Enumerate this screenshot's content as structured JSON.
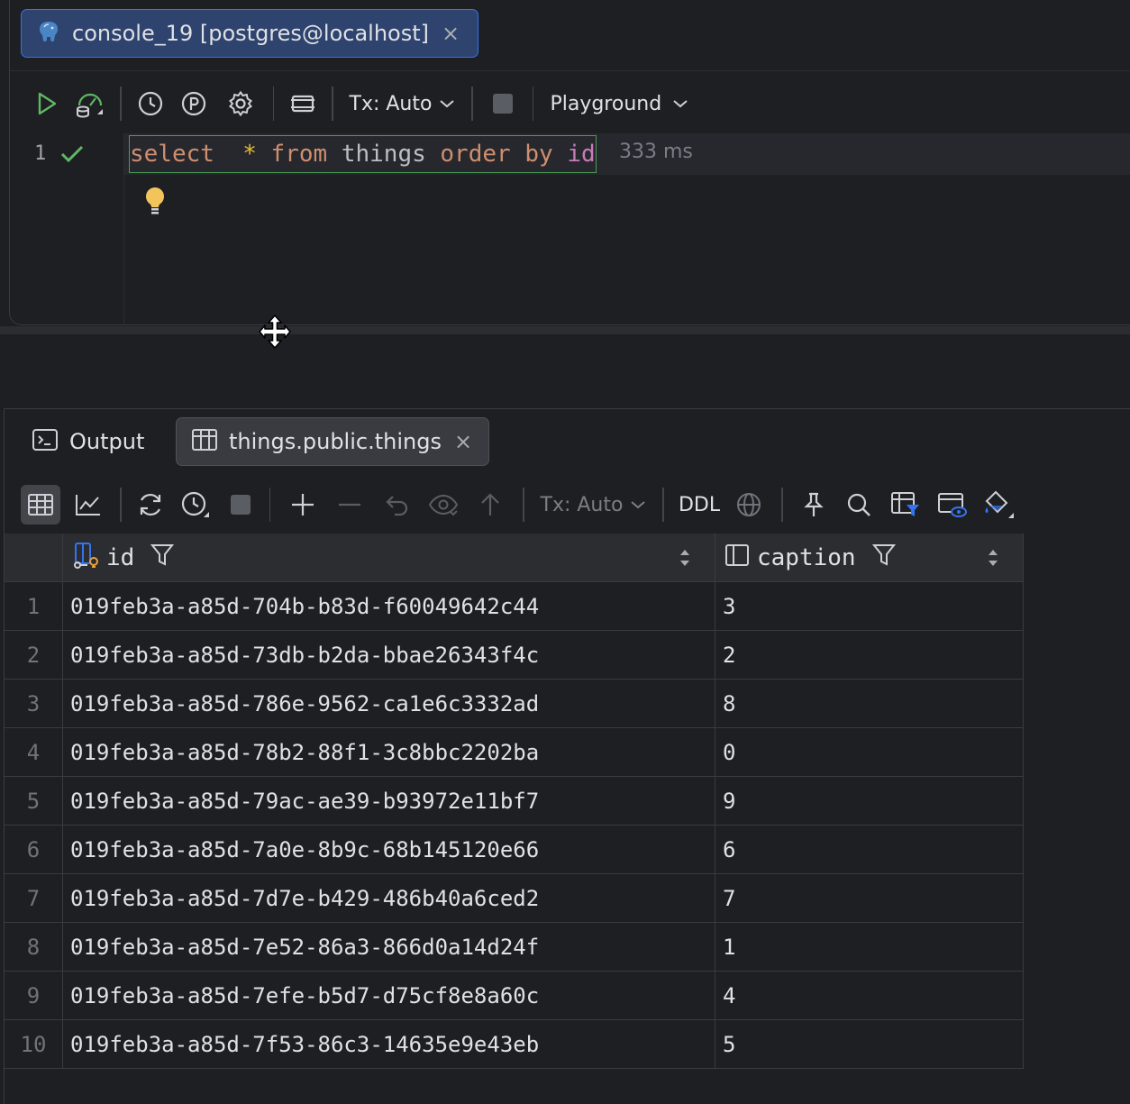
{
  "editor": {
    "tab": {
      "label": "console_19 [postgres@localhost]",
      "icon": "postgres-elephant-icon"
    },
    "toolbar": {
      "tx_mode": "Tx: Auto",
      "session": "Playground"
    },
    "line_number": "1",
    "query_tokens": [
      {
        "text": "select",
        "kind": "kw"
      },
      {
        "text": "  ",
        "kind": "ident"
      },
      {
        "text": "*",
        "kind": "op"
      },
      {
        "text": " ",
        "kind": "ident"
      },
      {
        "text": "from",
        "kind": "kw"
      },
      {
        "text": " things ",
        "kind": "ident"
      },
      {
        "text": "order",
        "kind": "kw"
      },
      {
        "text": " ",
        "kind": "ident"
      },
      {
        "text": "by",
        "kind": "kw"
      },
      {
        "text": " ",
        "kind": "ident"
      },
      {
        "text": "id",
        "kind": "col"
      }
    ],
    "timing": "333 ms"
  },
  "results": {
    "tabs": [
      {
        "label": "Output",
        "icon": "console-icon"
      },
      {
        "label": "things.public.things",
        "icon": "table-icon"
      }
    ],
    "toolbar": {
      "tx_mode": "Tx: Auto",
      "ddl": "DDL"
    },
    "columns": [
      {
        "name": "id"
      },
      {
        "name": "caption"
      }
    ],
    "rows": [
      {
        "n": "1",
        "id": "019feb3a-a85d-704b-b83d-f60049642c44",
        "caption": "3"
      },
      {
        "n": "2",
        "id": "019feb3a-a85d-73db-b2da-bbae26343f4c",
        "caption": "2"
      },
      {
        "n": "3",
        "id": "019feb3a-a85d-786e-9562-ca1e6c3332ad",
        "caption": "8"
      },
      {
        "n": "4",
        "id": "019feb3a-a85d-78b2-88f1-3c8bbc2202ba",
        "caption": "0"
      },
      {
        "n": "5",
        "id": "019feb3a-a85d-79ac-ae39-b93972e11bf7",
        "caption": "9"
      },
      {
        "n": "6",
        "id": "019feb3a-a85d-7a0e-8b9c-68b145120e66",
        "caption": "6"
      },
      {
        "n": "7",
        "id": "019feb3a-a85d-7d7e-b429-486b40a6ced2",
        "caption": "7"
      },
      {
        "n": "8",
        "id": "019feb3a-a85d-7e52-86a3-866d0a14d24f",
        "caption": "1"
      },
      {
        "n": "9",
        "id": "019feb3a-a85d-7efe-b5d7-d75cf8e8a60c",
        "caption": "4"
      },
      {
        "n": "10",
        "id": "019feb3a-a85d-7f53-86c3-14635e9e43eb",
        "caption": "5"
      }
    ]
  },
  "colors": {
    "background": "#1e1f22",
    "accent": "#3574f0",
    "success": "#5fb865",
    "keyword": "#cf8e6d"
  }
}
